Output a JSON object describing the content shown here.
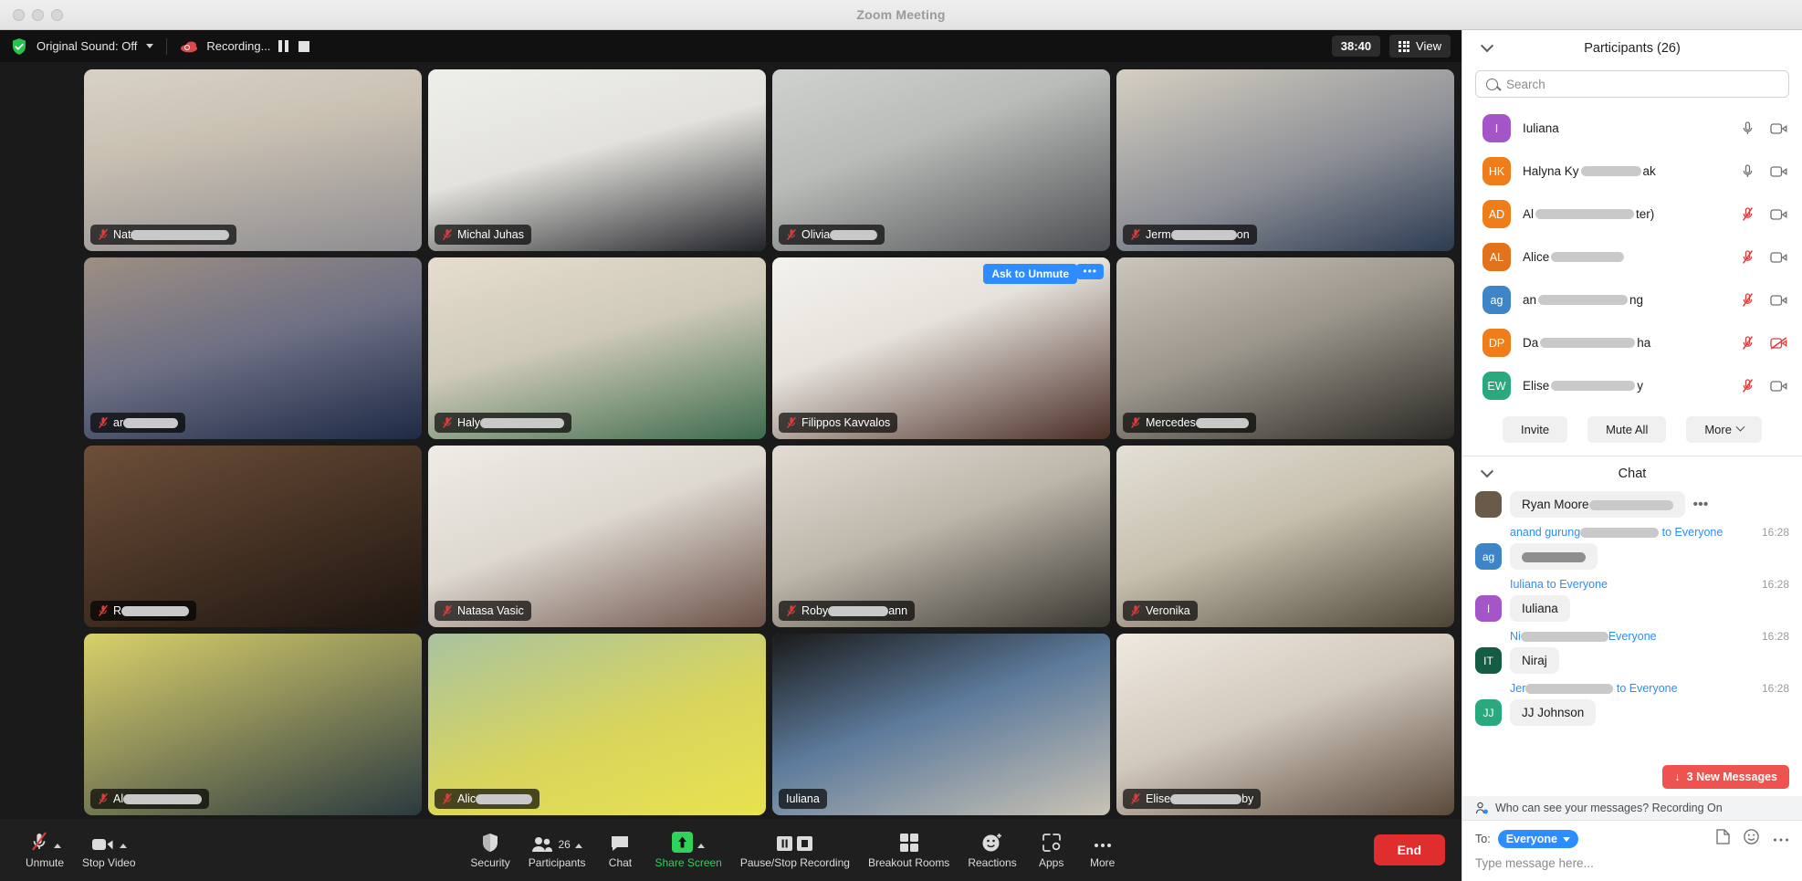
{
  "window": {
    "title": "Zoom Meeting"
  },
  "topbar": {
    "original_sound": "Original Sound: Off",
    "recording": "Recording...",
    "timer": "38:40",
    "view": "View"
  },
  "grid": {
    "ask_to_unmute": "Ask to Unmute",
    "more_dots": "•••",
    "tiles": [
      {
        "name": "Nat",
        "redacted": 108,
        "muted": true,
        "active": false,
        "bg": "linear-gradient(170deg,#d8d2c6 0%,#c9c0b2 38%,#8e8d91 100%)"
      },
      {
        "name": "Michal Juhas",
        "redacted": 0,
        "muted": true,
        "active": true,
        "bg": "linear-gradient(165deg,#efefea 0%,#e3e2dc 45%,#23242a 100%)"
      },
      {
        "name": "Olivia",
        "redacted": 52,
        "muted": true,
        "active": false,
        "bg": "linear-gradient(160deg,#cfd2cf 0%,#b9bbb8 40%,#4d4f53 100%)"
      },
      {
        "name": "Jerm",
        "redacted": 72,
        "suffix": "on",
        "muted": true,
        "active": false,
        "bg": "linear-gradient(160deg,#d6d0c2 0%,#8d8f96 55%,#2c3b52 100%)"
      },
      {
        "name": "ar",
        "redacted": 60,
        "muted": true,
        "active": false,
        "bg": "linear-gradient(165deg,#9d8f83 0%,#6d6f84 48%,#1e2a45 100%)"
      },
      {
        "name": "Haly",
        "redacted": 92,
        "muted": true,
        "active": false,
        "bg": "linear-gradient(165deg,#e6ddcf 0%,#cfcab9 45%,#3e6b4c 100%)"
      },
      {
        "name": "Filippos Kavvalos",
        "redacted": 0,
        "muted": true,
        "active": true,
        "bg": "linear-gradient(160deg,#f4f2ee 0%,#e6e2dc 40%,#4a2e26 100%)"
      },
      {
        "name": "Mercedes",
        "redacted": 58,
        "muted": true,
        "active": false,
        "bg": "linear-gradient(160deg,#cbc6bb 0%,#9b968c 45%,#2b2925 100%)"
      },
      {
        "name": "R",
        "redacted": 74,
        "muted": true,
        "active": false,
        "bg": "linear-gradient(160deg,#6d4f3a 0%,#4a3526 45%,#1d1510 100%)"
      },
      {
        "name": "Natasa Vasic",
        "redacted": 0,
        "muted": true,
        "active": false,
        "bg": "linear-gradient(160deg,#efece6 0%,#ddd8d0 45%,#6b5147 100%)"
      },
      {
        "name": "Roby",
        "redacted": 66,
        "suffix": "ann",
        "muted": true,
        "active": false,
        "bg": "linear-gradient(160deg,#e2ddd4 0%,#bdb6aa 45%,#3a3832 100%)"
      },
      {
        "name": "Veronika",
        "redacted": 0,
        "muted": true,
        "active": false,
        "bg": "linear-gradient(160deg,#e4e0d6 0%,#c6bfae 45%,#4c4436 100%)"
      },
      {
        "name": "Al",
        "redacted": 86,
        "muted": true,
        "active": false,
        "bg": "linear-gradient(160deg,#d9d06a 0%,#8f8f5a 45%,#2b3a3f 100%)"
      },
      {
        "name": "Alic",
        "redacted": 62,
        "muted": true,
        "active": false,
        "bg": "linear-gradient(160deg,#a9c3a0 0%,#d9d55c 55%,#e8e24f 100%)"
      },
      {
        "name": "Iuliana",
        "redacted": 0,
        "muted": false,
        "active": true,
        "bg": "linear-gradient(160deg,#1a1a1a 0%,#5d7b9c 45%,#c9c2b4 100%)"
      },
      {
        "name": "Elise",
        "redacted": 78,
        "suffix": "by",
        "muted": true,
        "active": false,
        "bg": "linear-gradient(160deg,#efe9df 0%,#d2c9bd 45%,#5a4a3c 100%)"
      }
    ]
  },
  "toolbar": {
    "unmute": "Unmute",
    "stop_video": "Stop Video",
    "security": "Security",
    "participants": "Participants",
    "participants_count": "26",
    "chat": "Chat",
    "share_screen": "Share Screen",
    "pause_stop_recording": "Pause/Stop Recording",
    "breakout_rooms": "Breakout Rooms",
    "reactions": "Reactions",
    "apps": "Apps",
    "more": "More",
    "end": "End"
  },
  "participants_panel": {
    "title": "Participants (26)",
    "search_placeholder": "Search",
    "items": [
      {
        "initials": "I",
        "color": "#a455c8",
        "name": "Iuliana",
        "redacted": 0,
        "muted": false,
        "video_off": false
      },
      {
        "initials": "HK",
        "color": "#ef7d1a",
        "name": "Halyna Ky",
        "redacted": 66,
        "suffix": "ak",
        "muted": false,
        "video_off": false
      },
      {
        "initials": "AD",
        "color": "#ef7d1a",
        "name": "Al ",
        "redacted": 108,
        "suffix": "ter)",
        "muted": true,
        "video_off": false
      },
      {
        "initials": "AL",
        "color": "#e2721b",
        "name": "Alice ",
        "redacted": 80,
        "muted": true,
        "video_off": false
      },
      {
        "initials": "ag",
        "color": "#3d85c6",
        "name": "an",
        "redacted": 98,
        "suffix": "ng",
        "muted": true,
        "video_off": false
      },
      {
        "initials": "DP",
        "color": "#ef7d1a",
        "name": "Da",
        "redacted": 104,
        "suffix": "ha",
        "muted": true,
        "video_off": true
      },
      {
        "initials": "EW",
        "color": "#2aa97e",
        "name": "Elise ",
        "redacted": 92,
        "suffix": "y",
        "muted": true,
        "video_off": false
      }
    ],
    "invite": "Invite",
    "mute_all": "Mute All",
    "more": "More"
  },
  "chat_panel": {
    "title": "Chat",
    "new_messages": "3 New Messages",
    "new_messages_arrow": "↓",
    "privacy_note": "Who can see your messages? Recording On",
    "to_label": "To:",
    "to_value": "Everyone",
    "input_placeholder": "Type message here...",
    "messages": [
      {
        "sender": "Ryan Moore",
        "redacted": 92,
        "is_photo": true,
        "color": "#6a5a4a",
        "initials": "",
        "recipient": "",
        "time": "",
        "text": "",
        "header_style": "pill",
        "dots": "•••"
      },
      {
        "sender": "anand gurung",
        "redacted": 86,
        "recipient": " to Everyone",
        "time": "16:28",
        "initials": "ag",
        "color": "#3d85c6",
        "text": "",
        "text_redacted": 70
      },
      {
        "sender": "Iuliana",
        "redacted": 0,
        "recipient": " to Everyone",
        "time": "16:28",
        "initials": "I",
        "color": "#a455c8",
        "text": "Iuliana"
      },
      {
        "sender": "Ni",
        "redacted": 96,
        "suffix": "",
        "recipient": "Everyone",
        "time": "16:28",
        "initials": "IT",
        "color": "#145c43",
        "text": "Niraj"
      },
      {
        "sender": "Jer",
        "redacted": 96,
        "recipient": " to Everyone",
        "time": "16:28",
        "initials": "JJ",
        "color": "#2aa97e",
        "text": "JJ Johnson"
      }
    ]
  }
}
